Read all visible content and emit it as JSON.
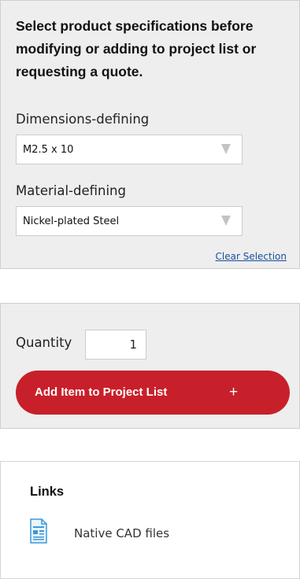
{
  "specifications": {
    "heading": "Select product specifications before modifying or adding to project list or requesting a quote.",
    "dimensions": {
      "label": "Dimensions-defining",
      "selected": "M2.5 x 10"
    },
    "material": {
      "label": "Material-defining",
      "selected": "Nickel-plated Steel"
    },
    "clear_selection": "Clear Selection"
  },
  "quantity": {
    "label": "Quantity",
    "value": "1"
  },
  "add_button": {
    "label": "Add Item to Project List",
    "icon": "+"
  },
  "links": {
    "title": "Links",
    "items": [
      {
        "label": "Native CAD files",
        "icon": "document-icon"
      }
    ]
  },
  "colors": {
    "accent": "#c8202a",
    "panel_bg": "#eeeeee",
    "link": "#1a4f9c",
    "icon": "#3a9ad9"
  }
}
